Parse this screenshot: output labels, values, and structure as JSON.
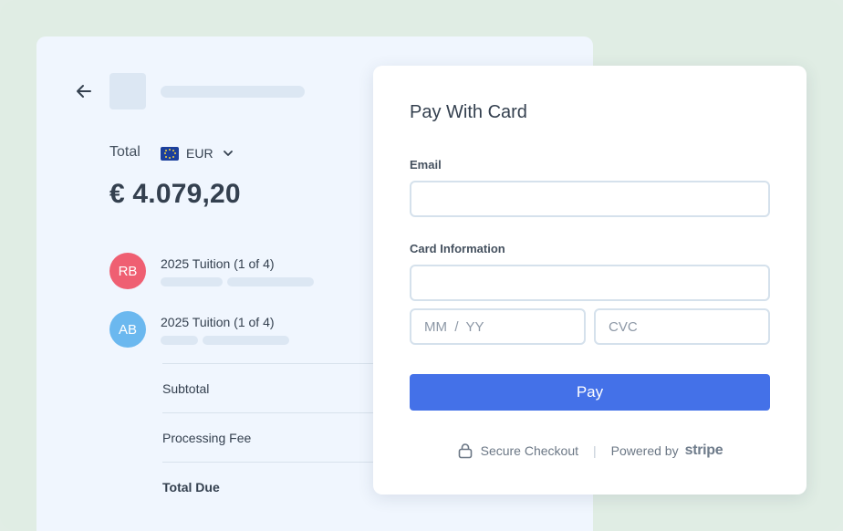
{
  "summary": {
    "total_label": "Total",
    "currency": "EUR",
    "amount": "€ 4.079,20",
    "items": [
      {
        "initials": "RB",
        "title": "2025 Tuition (1 of 4)",
        "avatar_color": "#ef5f72"
      },
      {
        "initials": "AB",
        "title": "2025 Tuition (1 of 4)",
        "avatar_color": "#6bb8ef"
      }
    ],
    "rows": [
      {
        "label": "Subtotal"
      },
      {
        "label": "Processing Fee"
      },
      {
        "label": "Total Due"
      }
    ]
  },
  "card": {
    "title": "Pay With Card",
    "email_label": "Email",
    "email_value": "",
    "card_label": "Card Information",
    "card_number_value": "",
    "expiry_placeholder": "MM  /  YY",
    "cvc_placeholder": "CVC",
    "pay_label": "Pay",
    "secure_text": "Secure Checkout",
    "divider": "|",
    "powered_by": "Powered by",
    "brand": "stripe"
  },
  "colors": {
    "background": "#e0ede4",
    "panel": "#f0f6fe",
    "accent": "#4471e8"
  },
  "icons": {
    "back": "arrow-left-icon",
    "currency_toggle": "chevron-down-icon",
    "flag": "eu-flag-icon",
    "secure": "lock-icon"
  }
}
